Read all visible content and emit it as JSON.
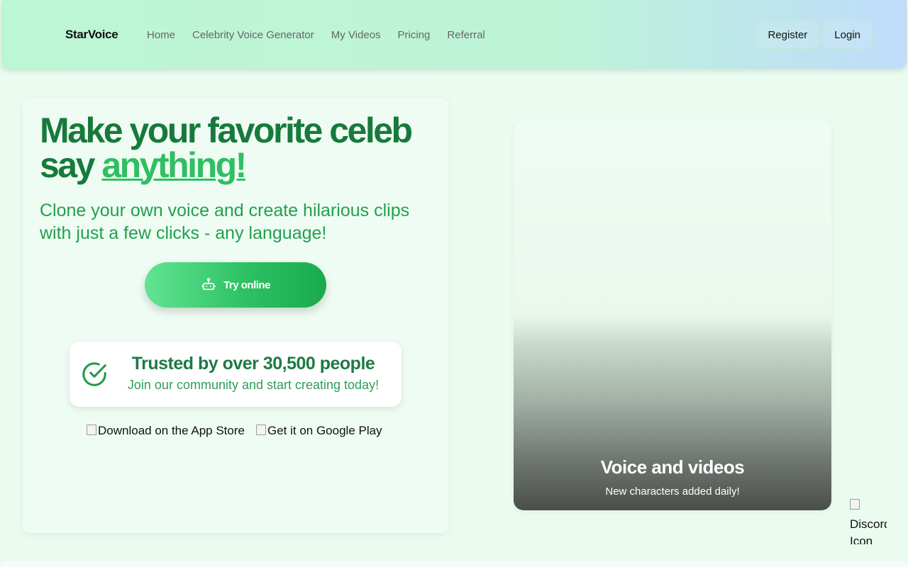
{
  "brand": "StarVoice",
  "nav": {
    "links": [
      "Home",
      "Celebrity Voice Generator",
      "My Videos",
      "Pricing",
      "Referral"
    ],
    "register": "Register",
    "login": "Login"
  },
  "hero": {
    "headline_main": "Make your favorite celeb say ",
    "headline_accent": "anything!",
    "subhead": "Clone your own voice and create hilarious clips with just a few clicks - any language!",
    "cta": "Try online",
    "cta_icon": "robot-icon",
    "trust_title": "Trusted by over 30,500 people",
    "trust_sub": "Join our community and start creating today!",
    "trust_icon": "check-circle-icon",
    "app_store": "Download on the App Store",
    "google_play": "Get it on Google Play"
  },
  "media": {
    "title": "Voice and videos",
    "subtitle": "New characters added daily!"
  },
  "discord_alt": "Discord Icon",
  "colors": {
    "primary_green": "#177a3c",
    "accent_green": "#2fbf62",
    "background": "#eafcef"
  }
}
